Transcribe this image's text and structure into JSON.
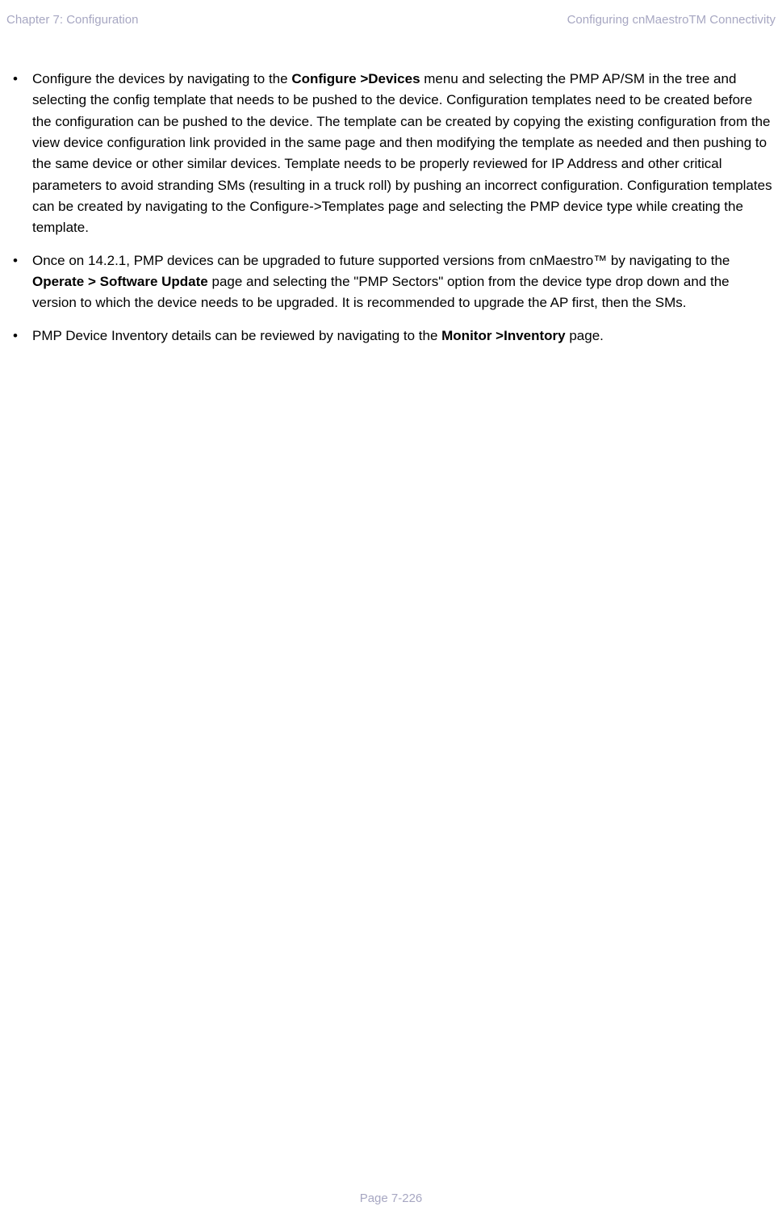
{
  "header": {
    "left": "Chapter 7:  Configuration",
    "right": "Configuring cnMaestroTM Connectivity"
  },
  "bullets": [
    {
      "pre": "Configure the devices by navigating to the ",
      "bold1": "Configure >Devices",
      "mid": " menu and selecting the PMP AP/SM in the tree and selecting the config template that needs to be pushed to the device. Configuration templates need to be created before the configuration can be pushed to the device. The template can be created by copying the existing configuration from the view device configuration link provided in the same page and then modifying the template as needed and then pushing to the same device or other similar devices. Template needs to be properly reviewed for IP Address and other critical parameters to avoid stranding SMs (resulting in a truck roll) by pushing an incorrect configuration. Configuration templates can be created by navigating to the Configure->Templates page and selecting the PMP device type while creating the template.",
      "bold2": "",
      "post": ""
    },
    {
      "pre": "Once on 14.2.1, PMP devices can be upgraded to future supported versions from cnMaestro™ by navigating to the ",
      "bold1": "Operate > Software Update",
      "mid": " page and selecting the \"PMP Sectors\" option from the device type drop down and the version to which the device needs to be upgraded. It is recommended to upgrade the AP first, then the SMs.",
      "bold2": "",
      "post": ""
    },
    {
      "pre": "PMP Device Inventory details can be reviewed by navigating to the ",
      "bold1": "Monitor >Inventory",
      "mid": " page.",
      "bold2": "",
      "post": ""
    }
  ],
  "footer": "Page 7-226"
}
